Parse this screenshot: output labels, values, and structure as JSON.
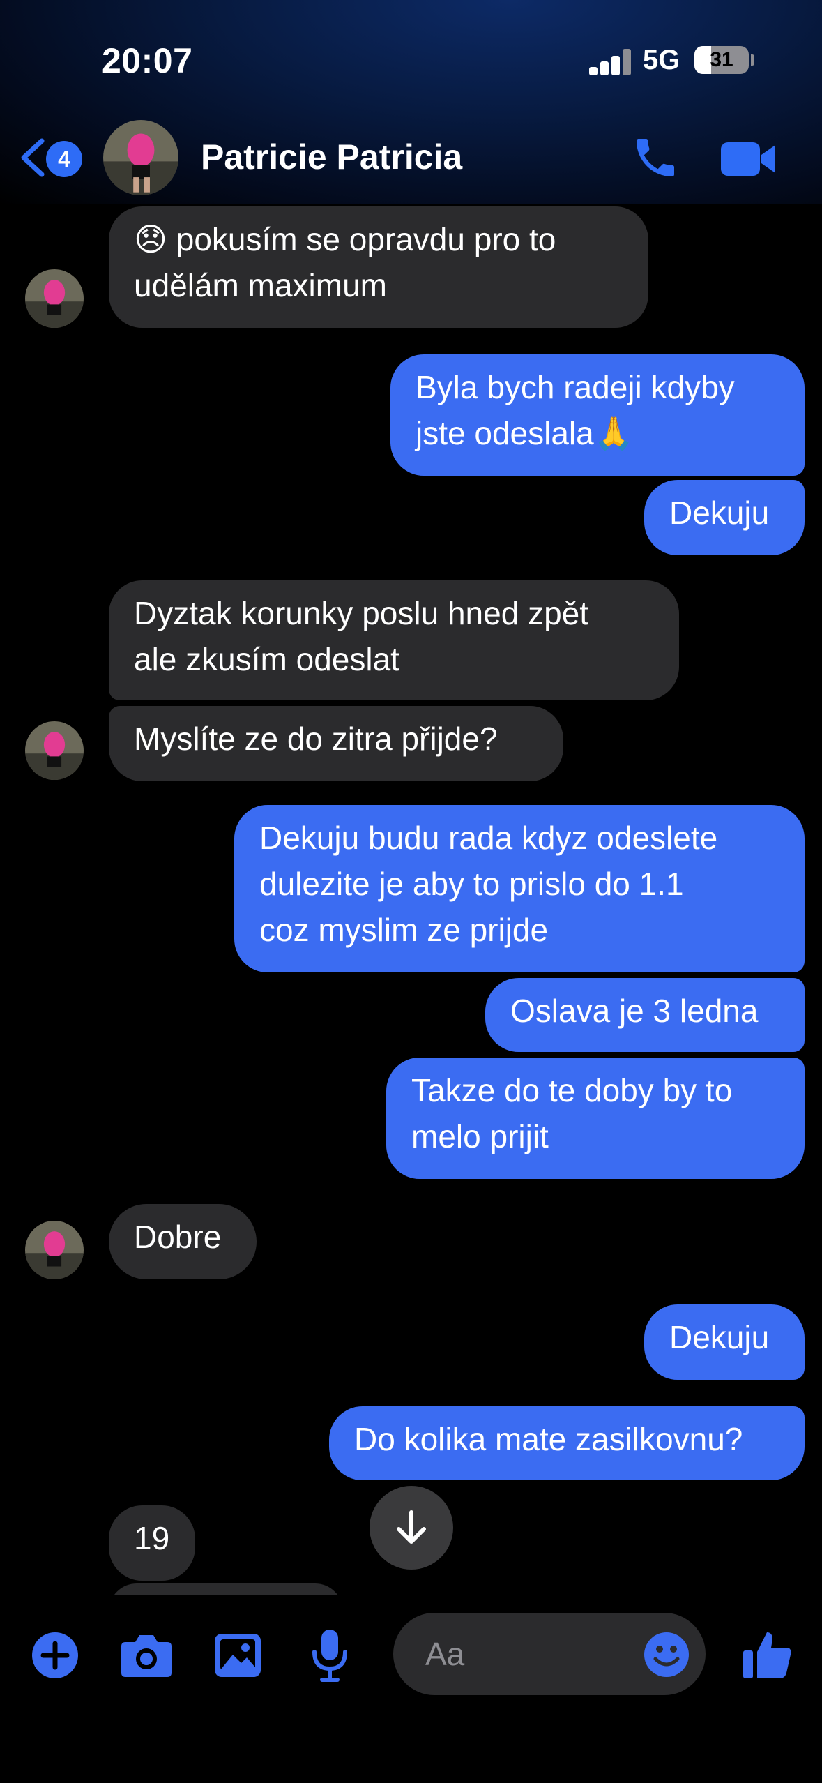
{
  "status_bar": {
    "time": "20:07",
    "network": "5G",
    "battery": "31",
    "battery_level": 0.31
  },
  "header": {
    "back_badge": "4",
    "contact_name": "Patricie Patricia"
  },
  "messages": [
    {
      "from": "them",
      "text_line1": "pokusím se opravdu pro to",
      "text_line2": "udělám maximum",
      "emoji": "😞"
    },
    {
      "from": "me",
      "text_line1": "Byla bych radeji kdyby",
      "text_line2": "jste odeslala",
      "emoji": "🙏"
    },
    {
      "from": "me",
      "text": "Dekuju"
    },
    {
      "from": "them",
      "text_line1": "Dyztak korunky poslu hned zpět",
      "text_line2": "ale zkusím odeslat"
    },
    {
      "from": "them",
      "text": "Myslíte ze do zitra přijde?"
    },
    {
      "from": "me",
      "text_line1": "Dekuju budu rada kdyz odeslete",
      "text_line2": "dulezite je aby to prislo do 1.1",
      "text_line3": "coz myslim ze prijde"
    },
    {
      "from": "me",
      "text": "Oslava je 3 ledna"
    },
    {
      "from": "me",
      "text_line1": "Takze do te doby by to",
      "text_line2": "melo prijit"
    },
    {
      "from": "them",
      "text": "Dobre"
    },
    {
      "from": "me",
      "text": "Dekuju"
    },
    {
      "from": "me",
      "text": "Do kolika mate zasilkovnu?"
    },
    {
      "from": "them",
      "text": "19"
    }
  ],
  "composer": {
    "placeholder": "Aa"
  },
  "icons": {
    "back": "chevron-left-icon",
    "call": "phone-icon",
    "video": "video-camera-icon",
    "plus": "plus-circle-icon",
    "camera": "camera-icon",
    "gallery": "image-icon",
    "mic": "microphone-icon",
    "emoji": "smiley-icon",
    "like": "thumbs-up-icon",
    "scroll": "arrow-down-icon"
  },
  "colors": {
    "accent": "#3b6cf2",
    "incoming_bubble": "#2b2b2d",
    "background": "#000000"
  }
}
